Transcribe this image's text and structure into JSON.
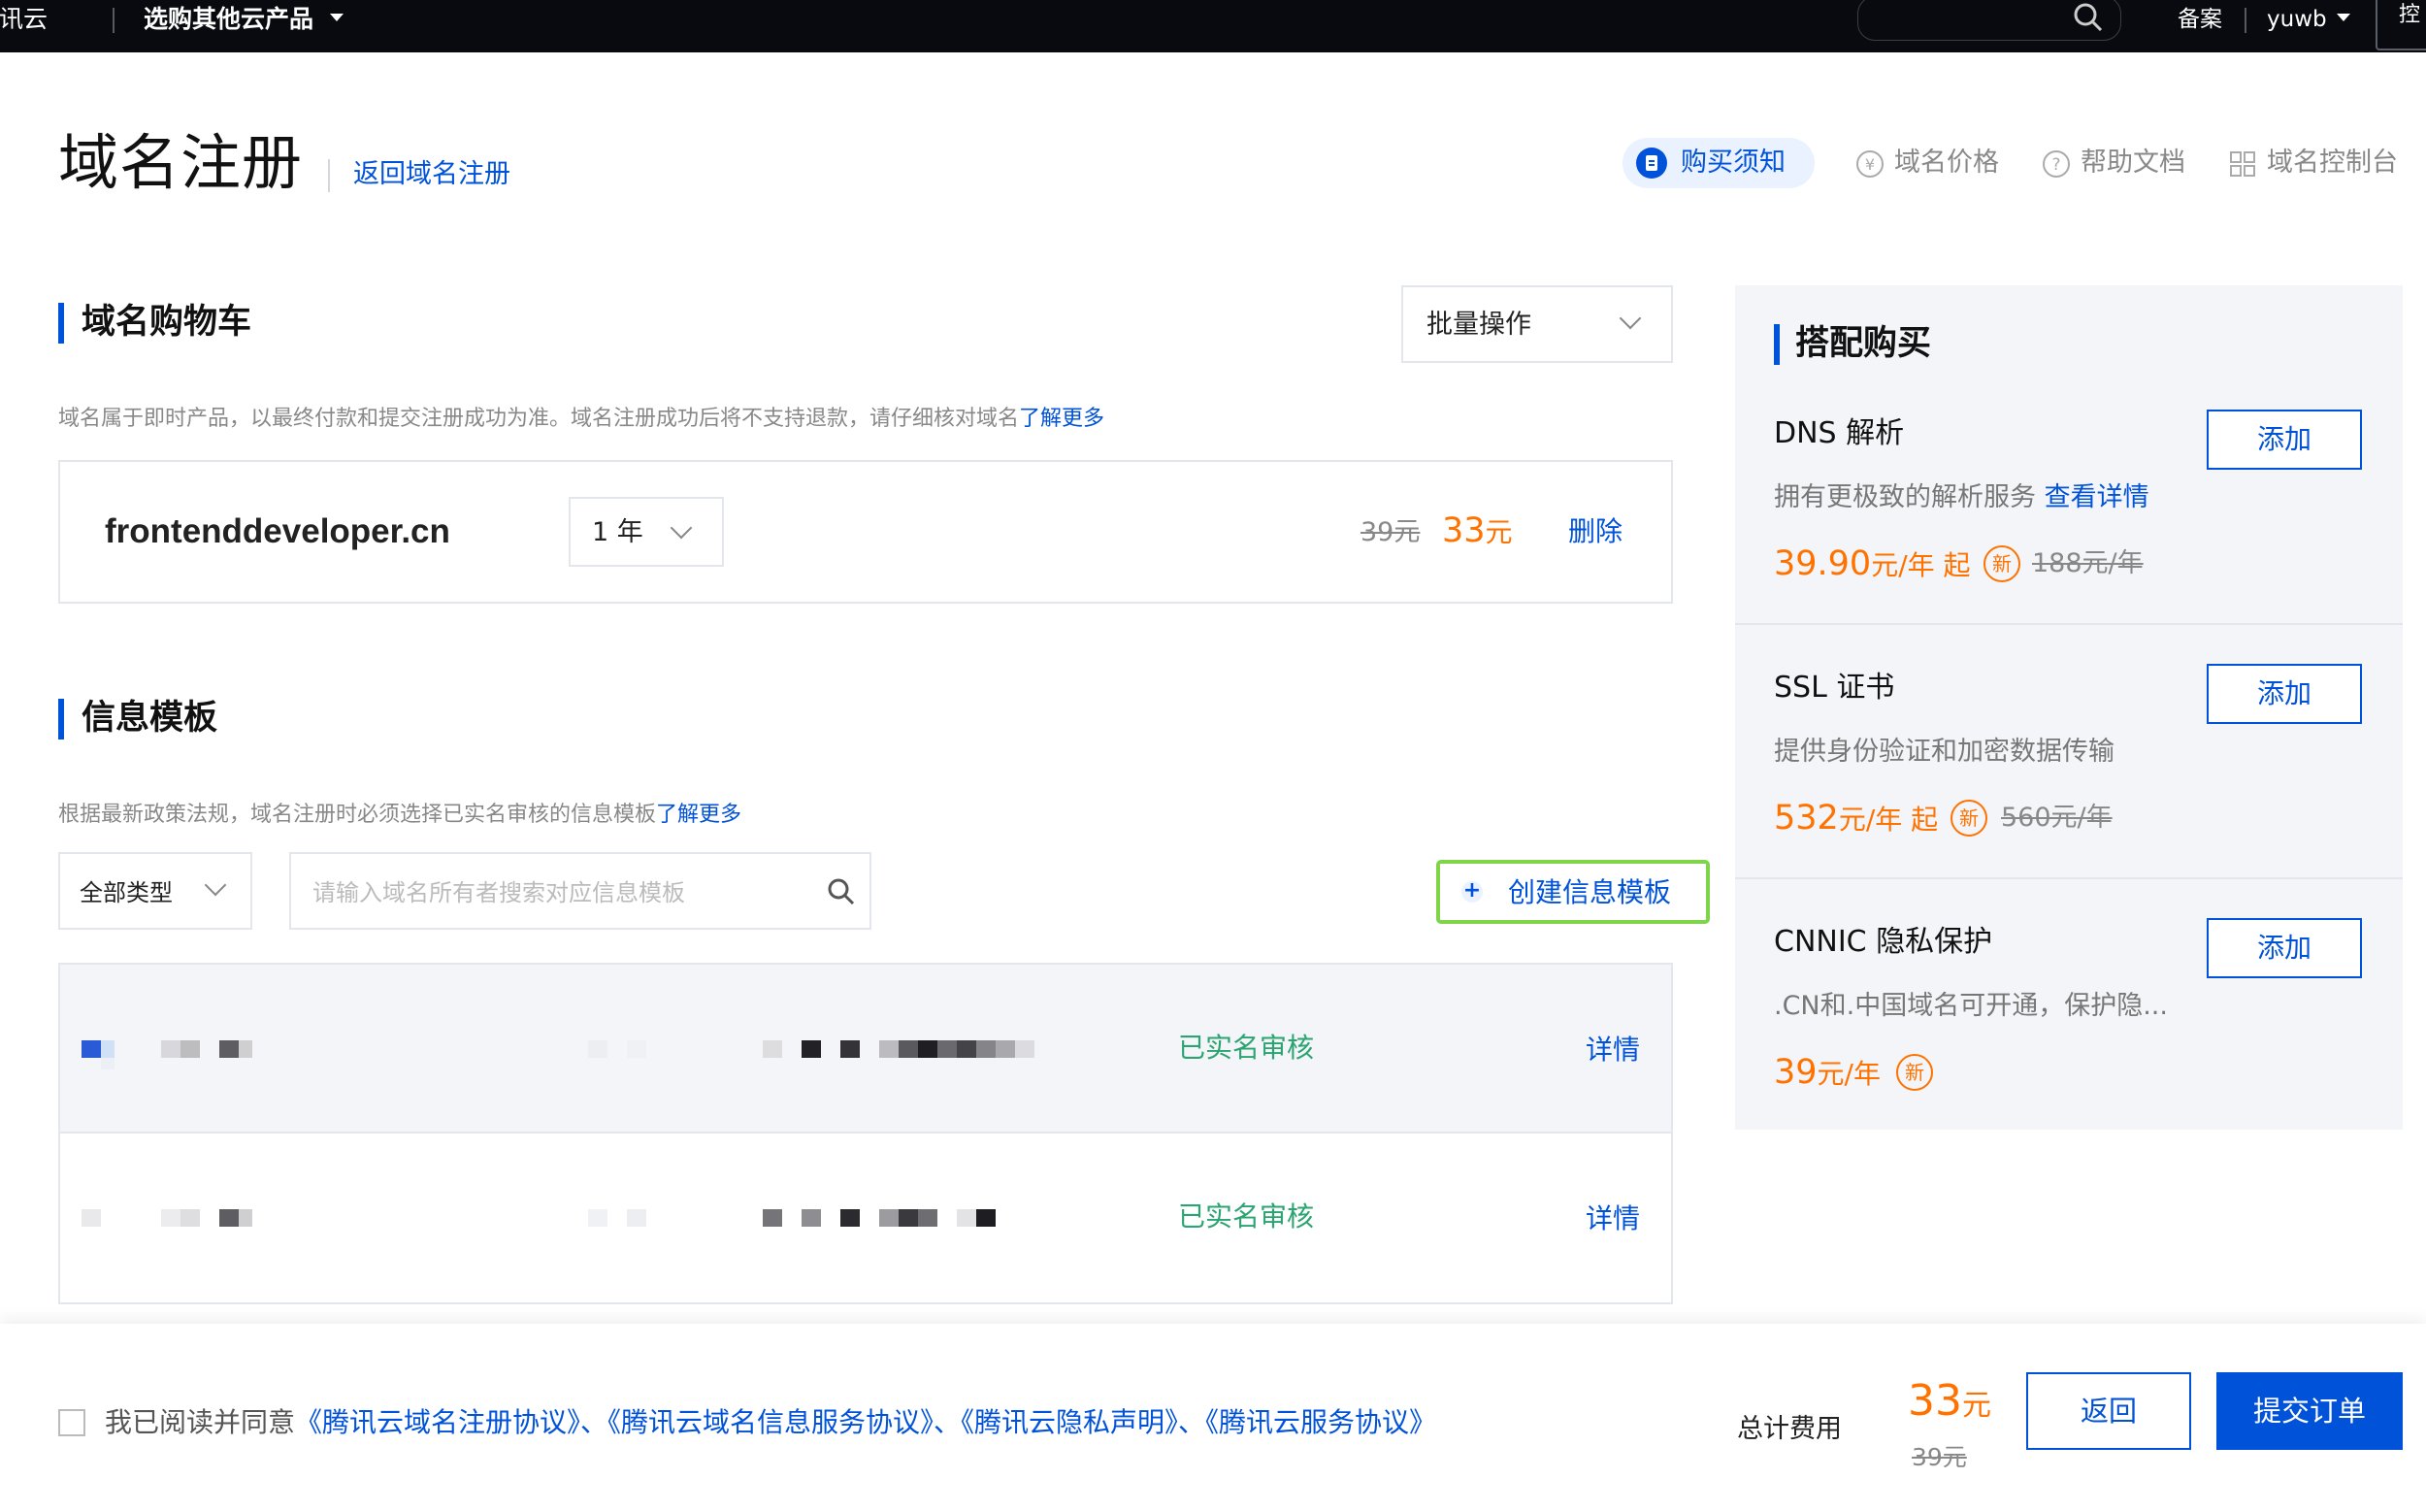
{
  "topbar": {
    "brand": "腾讯云",
    "products_menu": "选购其他云产品",
    "search_placeholder": "",
    "beian": "备案",
    "username": "yuwb",
    "right_button": "控"
  },
  "header": {
    "title": "域名注册",
    "back_link": "返回域名注册",
    "nav": [
      {
        "label": "购买须知",
        "icon": "document-icon",
        "active": true
      },
      {
        "label": "域名价格",
        "icon": "yen-icon"
      },
      {
        "label": "帮助文档",
        "icon": "question-icon"
      },
      {
        "label": "域名控制台",
        "icon": "grid-icon"
      }
    ]
  },
  "cart": {
    "title": "域名购物车",
    "batch_select": "批量操作",
    "note": "域名属于即时产品，以最终付款和提交注册成功为准。域名注册成功后将不支持退款，请仔细核对域名",
    "learn_more": "了解更多",
    "item": {
      "domain": "frontenddeveloper.cn",
      "period": "1 年",
      "original_price": "39元",
      "price_value": "33",
      "price_unit": "元",
      "delete": "删除"
    }
  },
  "templates": {
    "title": "信息模板",
    "note": "根据最新政策法规，域名注册时必须选择已实名审核的信息模板",
    "learn_more": "了解更多",
    "type_filter": "全部类型",
    "search_placeholder": "请输入域名所有者搜索对应信息模板",
    "create_button": "创建信息模板",
    "rows": [
      {
        "status": "已实名审核",
        "detail": "详情"
      },
      {
        "status": "已实名审核",
        "detail": "详情"
      }
    ]
  },
  "sidebar": {
    "title": "搭配购买",
    "items": [
      {
        "name": "DNS 解析",
        "desc": "拥有更极致的解析服务",
        "desc_link": "查看详情",
        "price": "39.90",
        "unit": "元/年 起",
        "badge": "新",
        "original": "188元/年",
        "add": "添加"
      },
      {
        "name": "SSL 证书",
        "desc": "提供身份验证和加密数据传输",
        "desc_link": "",
        "price": "532",
        "unit": "元/年 起",
        "badge": "新",
        "original": "560元/年",
        "add": "添加"
      },
      {
        "name": "CNNIC 隐私保护",
        "desc": ".CN和.中国域名可开通，保护隐...",
        "desc_link": "",
        "price": "39",
        "unit": "元/年",
        "badge": "新",
        "original": "",
        "add": "添加"
      }
    ]
  },
  "footer": {
    "agree_text": "我已阅读并同意",
    "agreements": "《腾讯云域名注册协议》、《腾讯云域名信息服务协议》、《腾讯云隐私声明》、《腾讯云服务协议》",
    "total_label": "总计费用",
    "total_value": "33",
    "total_unit": "元",
    "total_original": "39元",
    "return_button": "返回",
    "submit_button": "提交订单"
  },
  "colors": {
    "topbar": "#080a0f",
    "brand_blue": "#0052d9",
    "price_orange": "#ff7200",
    "status_green": "#2ba471",
    "highlight_outline": "#7fd44a",
    "panel_bg": "#f3f5f9"
  }
}
